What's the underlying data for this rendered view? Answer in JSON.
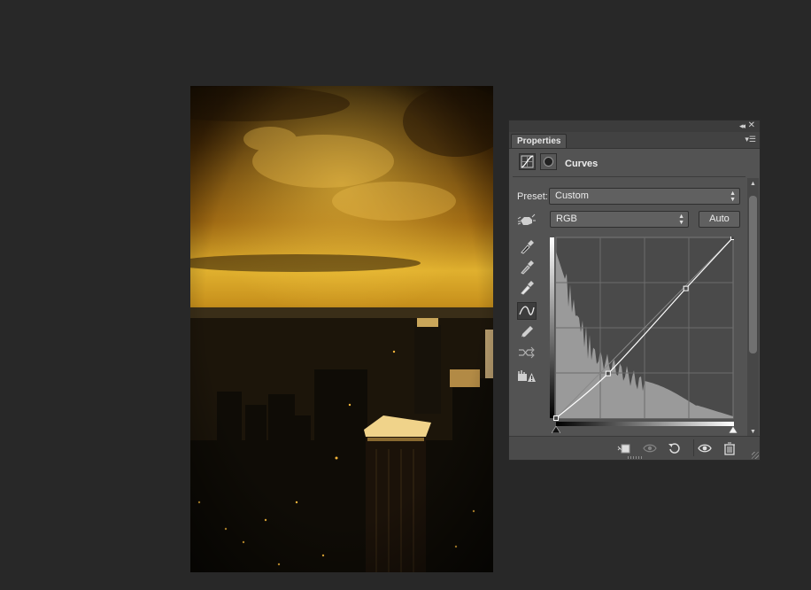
{
  "panel": {
    "tab_label": "Properties",
    "title": "Curves",
    "preset_label": "Preset:",
    "preset_value": "Custom",
    "channel_value": "RGB",
    "auto_label": "Auto",
    "header_icons": [
      "curves-adjustment-icon",
      "layer-mask-icon"
    ],
    "tools": [
      "on-image-adjust-hand-icon",
      "black-point-eyedropper-icon",
      "gray-point-eyedropper-icon",
      "white-point-eyedropper-icon",
      "edit-points-curve-icon",
      "draw-pencil-icon",
      "smooth-curve-icon",
      "clipping-warning-icon"
    ],
    "footer_icons": [
      "clip-to-layer-icon",
      "view-previous-state-icon",
      "reset-icon",
      "visibility-eye-icon",
      "trash-icon"
    ]
  },
  "curve": {
    "control_points": [
      [
        0,
        0
      ],
      [
        75,
        63
      ],
      [
        187,
        183
      ],
      [
        255,
        255
      ]
    ],
    "histogram_color": "#9a9a9a",
    "curve_color": "#ffffff"
  },
  "colors": {
    "workspace_bg": "#282828",
    "panel_bg": "#535353",
    "graph_bg": "#4a4a4a",
    "accent": "#e0a52a"
  }
}
